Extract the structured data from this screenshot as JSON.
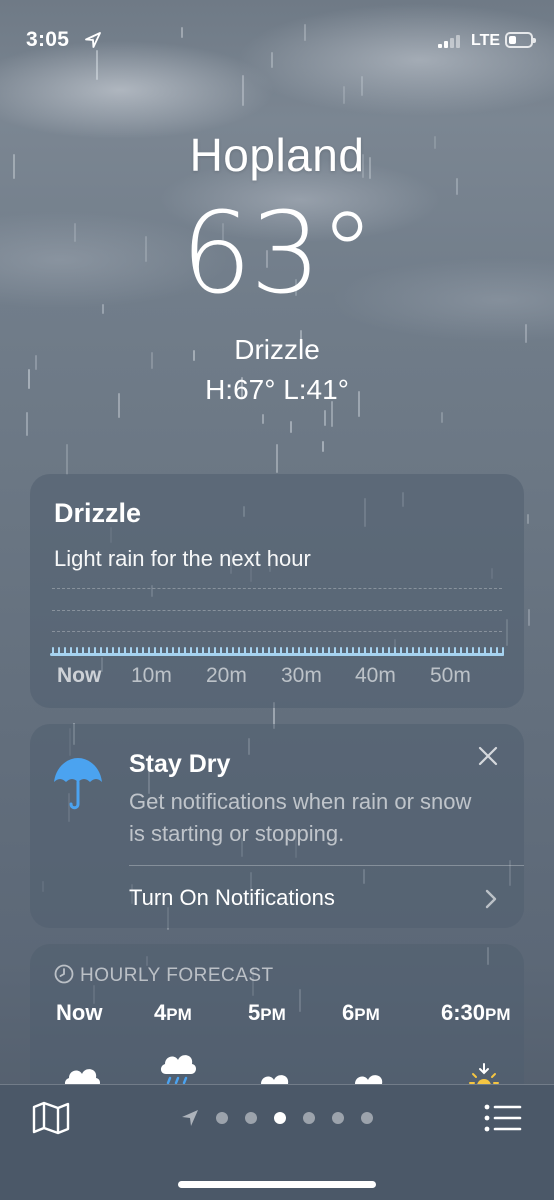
{
  "status_bar": {
    "time": "3:05",
    "network": "LTE",
    "signal_bars_on": 2,
    "battery_level": 0.35
  },
  "location": {
    "city": "Hopland",
    "temperature": "63°",
    "condition": "Drizzle",
    "high_low": "H:67°  L:41°"
  },
  "precip_card": {
    "title": "Drizzle",
    "description": "Light rain for the next hour",
    "time_labels": [
      "Now",
      "10m",
      "20m",
      "30m",
      "40m",
      "50m"
    ],
    "bar_color": "#a6d3f0"
  },
  "notify_card": {
    "title": "Stay Dry",
    "body": "Get notifications when rain or snow is starting or stopping.",
    "action": "Turn On Notifications",
    "icon": "umbrella-icon",
    "icon_color": "#4ba3f0"
  },
  "hourly_card": {
    "header": "HOURLY FORECAST",
    "hours": [
      {
        "label": "Now",
        "suffix": "",
        "icon": "cloud-icon"
      },
      {
        "label": "4",
        "suffix": "PM",
        "icon": "cloud-rain-icon"
      },
      {
        "label": "5",
        "suffix": "PM",
        "icon": "cloud-icon"
      },
      {
        "label": "6",
        "suffix": "PM",
        "icon": "cloud-icon"
      },
      {
        "label": "6:30",
        "suffix": "PM",
        "icon": "sunset-icon"
      }
    ]
  },
  "bottom_bar": {
    "page_count": 6,
    "active_page": 2
  }
}
